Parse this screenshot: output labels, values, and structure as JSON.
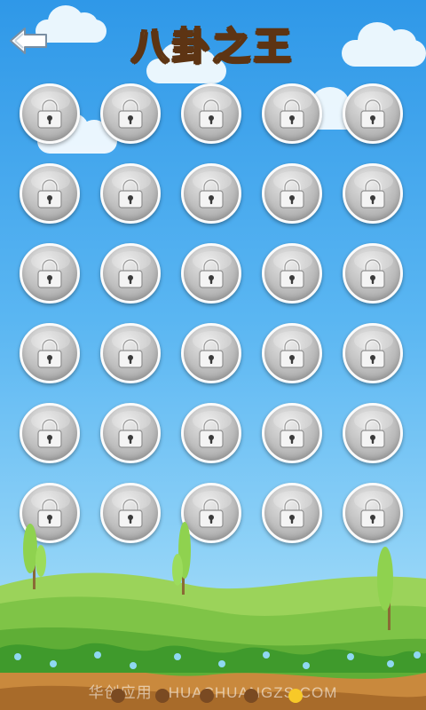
{
  "header": {
    "title": "八卦之王",
    "back_icon": "back-arrow-icon"
  },
  "levels": {
    "rows": 6,
    "columns": 5,
    "state": "locked",
    "icon": "padlock-icon",
    "count": 30
  },
  "pager": {
    "pages": 5,
    "current": 5,
    "active_color": "#f7c928",
    "inactive_color": "#7a4a22"
  },
  "watermark": {
    "text": "华创应用 · HUACHUANGZS.COM"
  },
  "colors": {
    "sky_top": "#2f98e8",
    "title_fill": "#f7cf62",
    "title_outline": "#5d3413"
  }
}
